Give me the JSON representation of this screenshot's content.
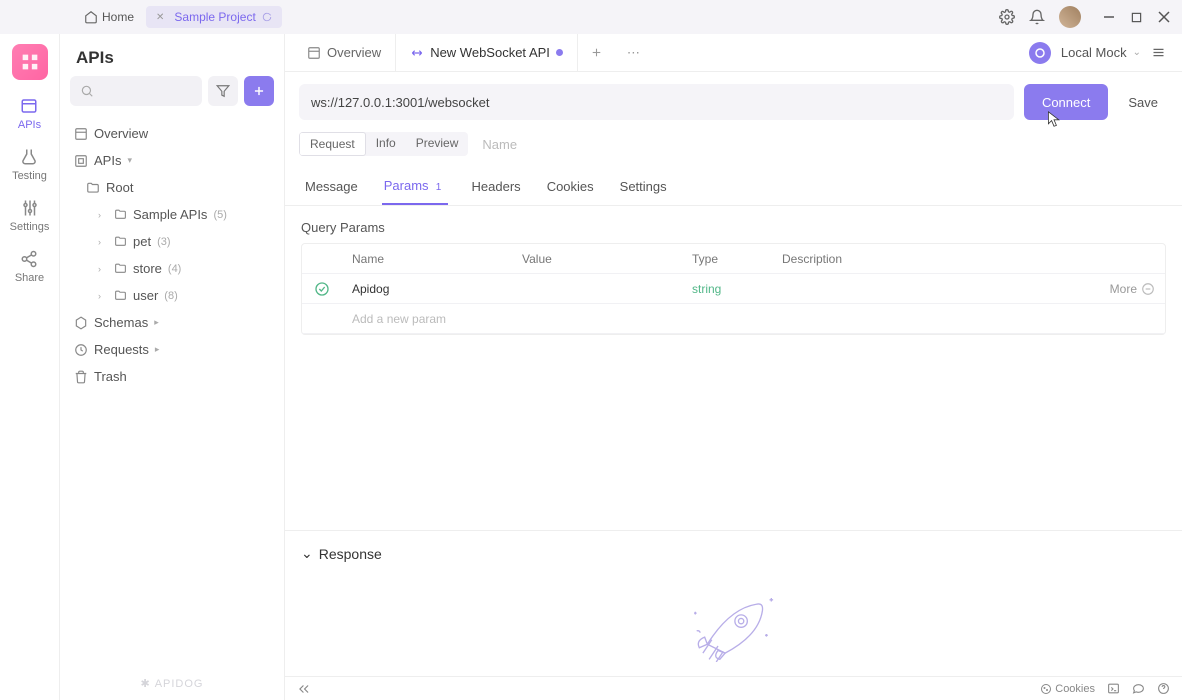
{
  "titlebar": {
    "home": "Home",
    "project": "Sample Project"
  },
  "rail": {
    "apis": "APIs",
    "testing": "Testing",
    "settings": "Settings",
    "share": "Share"
  },
  "sidebar": {
    "title": "APIs",
    "search_placeholder": "",
    "overview": "Overview",
    "apis_node": "APIs",
    "root": "Root",
    "folders": [
      {
        "label": "Sample APIs",
        "count": "(5)"
      },
      {
        "label": "pet",
        "count": "(3)"
      },
      {
        "label": "store",
        "count": "(4)"
      },
      {
        "label": "user",
        "count": "(8)"
      }
    ],
    "schemas": "Schemas",
    "requests": "Requests",
    "trash": "Trash",
    "brand": "APIDOG"
  },
  "tabs": {
    "overview": "Overview",
    "ws": "New WebSocket API"
  },
  "env": {
    "label": "Local Mock"
  },
  "request": {
    "url": "ws://127.0.0.1:3001/websocket",
    "connect": "Connect",
    "save": "Save",
    "segments": {
      "request": "Request",
      "info": "Info",
      "preview": "Preview"
    },
    "name_placeholder": "Name"
  },
  "subtabs": {
    "message": "Message",
    "params": "Params",
    "params_count": "1",
    "headers": "Headers",
    "cookies": "Cookies",
    "settings": "Settings"
  },
  "params": {
    "section_title": "Query Params",
    "headers": {
      "name": "Name",
      "value": "Value",
      "type": "Type",
      "description": "Description"
    },
    "rows": [
      {
        "name": "Apidog",
        "value": "",
        "type": "string",
        "description": ""
      }
    ],
    "more": "More",
    "add_placeholder": "Add a new param"
  },
  "response": {
    "title": "Response"
  },
  "bottombar": {
    "cookies": "Cookies"
  }
}
